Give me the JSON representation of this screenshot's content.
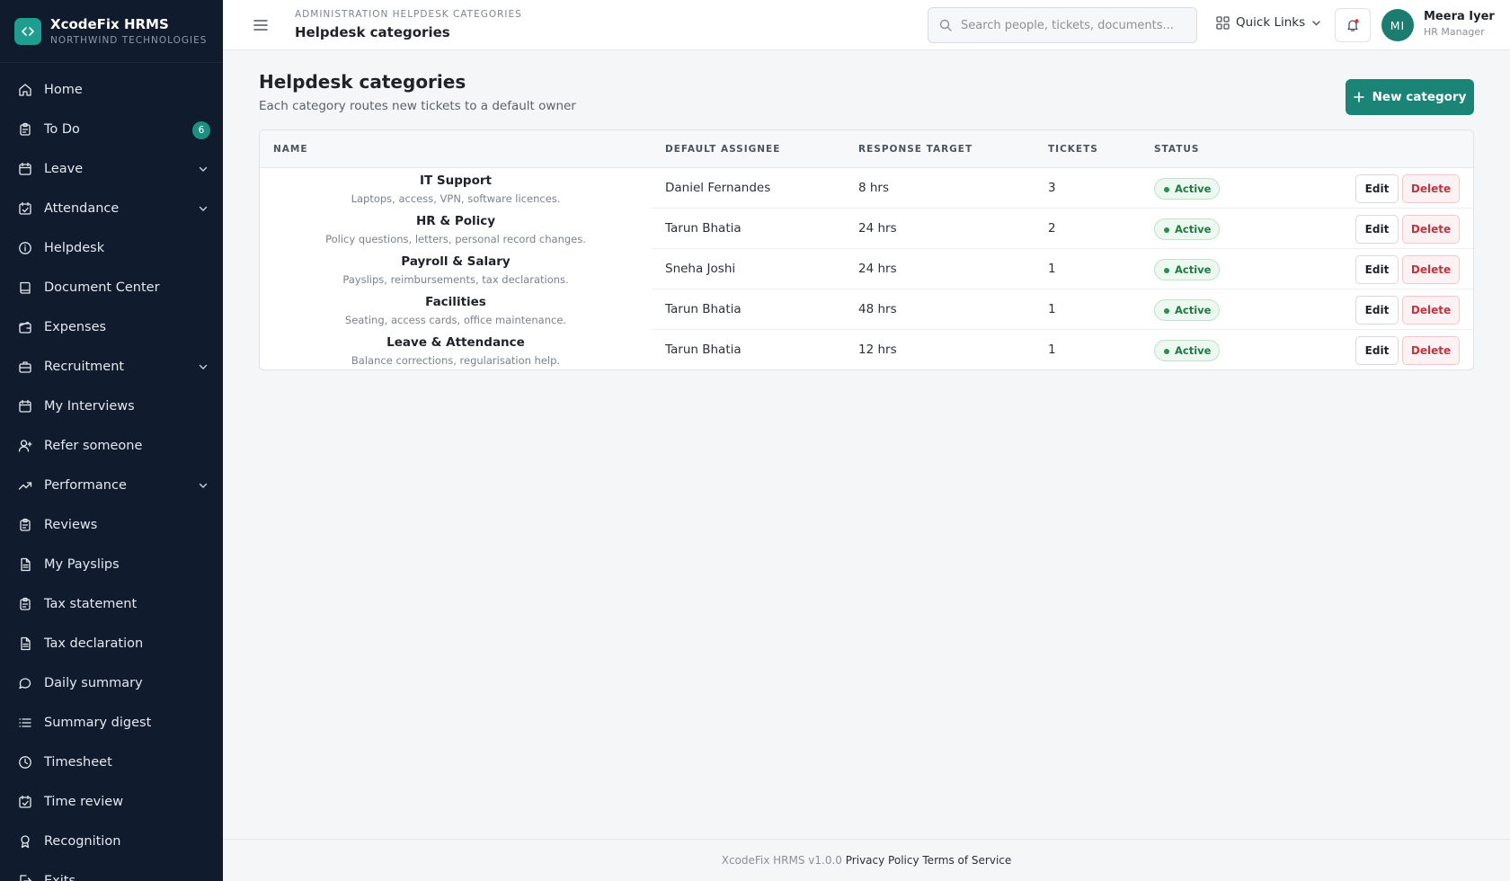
{
  "brand": {
    "name": "XcodeFix HRMS",
    "org": "NORTHWIND TECHNOLOGIES"
  },
  "sidebar": {
    "items": [
      {
        "label": "Home",
        "icon": "home-icon"
      },
      {
        "label": "To Do",
        "icon": "clipboard-icon",
        "badge": "6"
      },
      {
        "label": "Leave",
        "icon": "calendar-icon",
        "expandable": true
      },
      {
        "label": "Attendance",
        "icon": "calendar-check-icon",
        "expandable": true
      },
      {
        "label": "Helpdesk",
        "icon": "info-icon"
      },
      {
        "label": "Document Center",
        "icon": "book-icon"
      },
      {
        "label": "Expenses",
        "icon": "wallet-icon"
      },
      {
        "label": "Recruitment",
        "icon": "briefcase-icon",
        "expandable": true
      },
      {
        "label": "My Interviews",
        "icon": "calendar-icon"
      },
      {
        "label": "Refer someone",
        "icon": "user-plus-icon"
      },
      {
        "label": "Performance",
        "icon": "trending-up-icon",
        "expandable": true
      },
      {
        "label": "Reviews",
        "icon": "clipboard-icon"
      },
      {
        "label": "My Payslips",
        "icon": "file-icon"
      },
      {
        "label": "Tax statement",
        "icon": "clipboard-icon"
      },
      {
        "label": "Tax declaration",
        "icon": "file-icon"
      },
      {
        "label": "Daily summary",
        "icon": "chat-icon"
      },
      {
        "label": "Summary digest",
        "icon": "list-icon"
      },
      {
        "label": "Timesheet",
        "icon": "clock-icon"
      },
      {
        "label": "Time review",
        "icon": "calendar-check-icon"
      },
      {
        "label": "Recognition",
        "icon": "award-icon"
      },
      {
        "label": "Exits",
        "icon": "exit-icon"
      }
    ]
  },
  "topbar": {
    "breadcrumb": "ADMINISTRATION HELPDESK CATEGORIES",
    "title": "Helpdesk categories",
    "search_placeholder": "Search people, tickets, documents...",
    "quick_links": "Quick Links",
    "user": {
      "initials": "MI",
      "name": "Meera Iyer",
      "role": "HR Manager"
    }
  },
  "main": {
    "title": "Helpdesk categories",
    "subtitle": "Each category routes new tickets to a default owner",
    "new_button": "New category",
    "columns": [
      "NAME",
      "DEFAULT ASSIGNEE",
      "RESPONSE TARGET",
      "TICKETS",
      "STATUS"
    ],
    "edit_label": "Edit",
    "delete_label": "Delete",
    "rows": [
      {
        "name": "IT Support",
        "desc": "Laptops, access, VPN, software licences.",
        "assignee": "Daniel Fernandes",
        "target": "8 hrs",
        "tickets": "3",
        "status": "Active"
      },
      {
        "name": "HR & Policy",
        "desc": "Policy questions, letters, personal record changes.",
        "assignee": "Tarun Bhatia",
        "target": "24 hrs",
        "tickets": "2",
        "status": "Active"
      },
      {
        "name": "Payroll & Salary",
        "desc": "Payslips, reimbursements, tax declarations.",
        "assignee": "Sneha Joshi",
        "target": "24 hrs",
        "tickets": "1",
        "status": "Active"
      },
      {
        "name": "Facilities",
        "desc": "Seating, access cards, office maintenance.",
        "assignee": "Tarun Bhatia",
        "target": "48 hrs",
        "tickets": "1",
        "status": "Active"
      },
      {
        "name": "Leave & Attendance",
        "desc": "Balance corrections, regularisation help.",
        "assignee": "Tarun Bhatia",
        "target": "12 hrs",
        "tickets": "1",
        "status": "Active"
      }
    ]
  },
  "footer": {
    "version": "XcodeFix HRMS v1.0.0",
    "privacy": "Privacy Policy",
    "terms": "Terms of Service"
  },
  "colors": {
    "sidebar_bg": "#101b2d",
    "accent": "#1a8577",
    "danger": "#c0353f",
    "success": "#1f7a44"
  }
}
